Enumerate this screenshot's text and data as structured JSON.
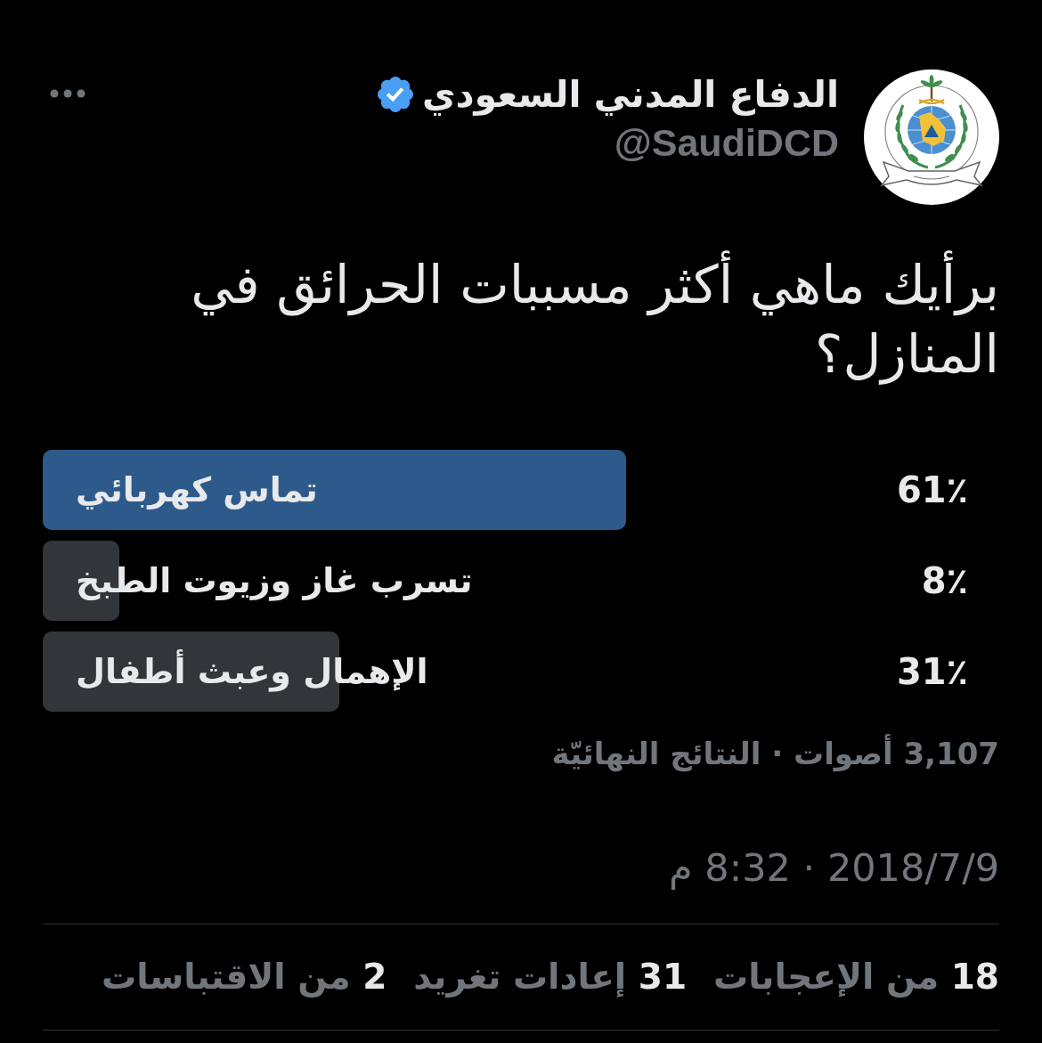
{
  "tweet": {
    "author": {
      "name": "الدفاع المدني السعودي",
      "verified": true,
      "handle": "@SaudiDCD"
    },
    "text": "برأيك ماهي أكثر مسببات الحرائق في المنازل؟",
    "poll": {
      "options": [
        {
          "label": "تماس كهربائي",
          "percent": "61٪",
          "level": 0.61,
          "winner": true
        },
        {
          "label": "تسرب غاز وزيوت الطبخ",
          "percent": "8٪",
          "level": 0.08,
          "winner": false
        },
        {
          "label": "الإهمال وعبث أطفال",
          "percent": "31٪",
          "level": 0.31,
          "winner": false
        }
      ],
      "summary": "3,107 أصوات · النتائج النهائيّة"
    },
    "timestamp": "2018/7/9 · 8:32 م",
    "stats": [
      {
        "count": "18",
        "label": "من الإعجابات"
      },
      {
        "count": "31",
        "label": "إعادات تغريد"
      },
      {
        "count": "2",
        "label": "من الاقتباسات"
      }
    ]
  }
}
